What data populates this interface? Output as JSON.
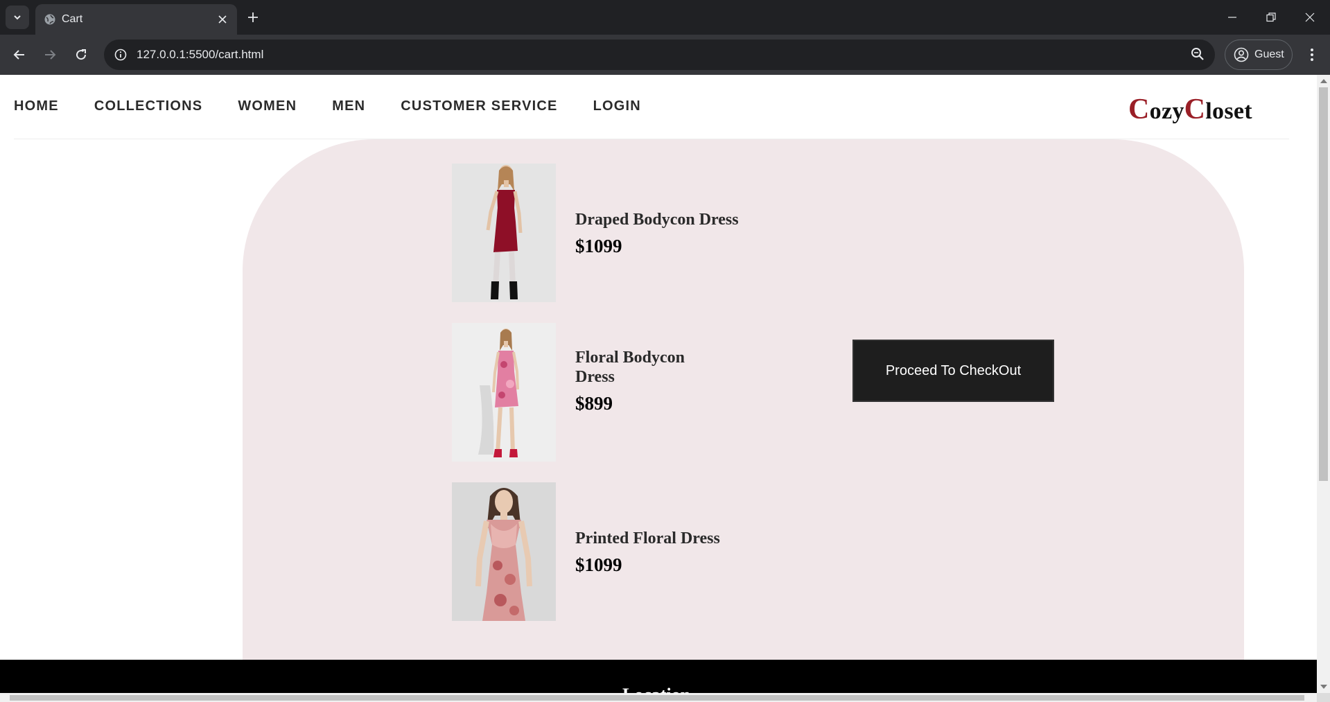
{
  "browser": {
    "tab_title": "Cart",
    "url": "127.0.0.1:5500/cart.html",
    "profile_label": "Guest",
    "icons": {
      "tab_list": "chevron-down-icon",
      "tab_favicon": "globe-icon",
      "tab_close": "close-icon",
      "new_tab": "plus-icon",
      "back": "arrow-left-icon",
      "forward": "arrow-right-icon",
      "reload": "reload-icon",
      "site_info": "info-icon",
      "zoom": "zoom-icon",
      "profile": "account-circle-icon",
      "menu": "more-vert-icon"
    }
  },
  "site": {
    "nav": [
      "HOME",
      "COLLECTIONS",
      "WOMEN",
      "MEN",
      "CUSTOMER SERVICE",
      "LOGIN"
    ],
    "logo": {
      "c1": "C",
      "w1": "ozy",
      "c2": "C",
      "w2": "loset"
    },
    "brand_color": "#9a1f27"
  },
  "cart": {
    "items": [
      {
        "name": "Draped Bodycon Dress",
        "price": "$1099",
        "dress_color": "#8e0f27"
      },
      {
        "name": "Floral Bodycon Dress",
        "price": "$899",
        "dress_color": "#e27fa2"
      },
      {
        "name": "Printed Floral Dress",
        "price": "$1099",
        "dress_color": "#d99a98"
      }
    ],
    "checkout_label": "Proceed To CheckOut",
    "panel_color": "#f1e7e9"
  },
  "footer": {
    "peek_text": "Location"
  }
}
